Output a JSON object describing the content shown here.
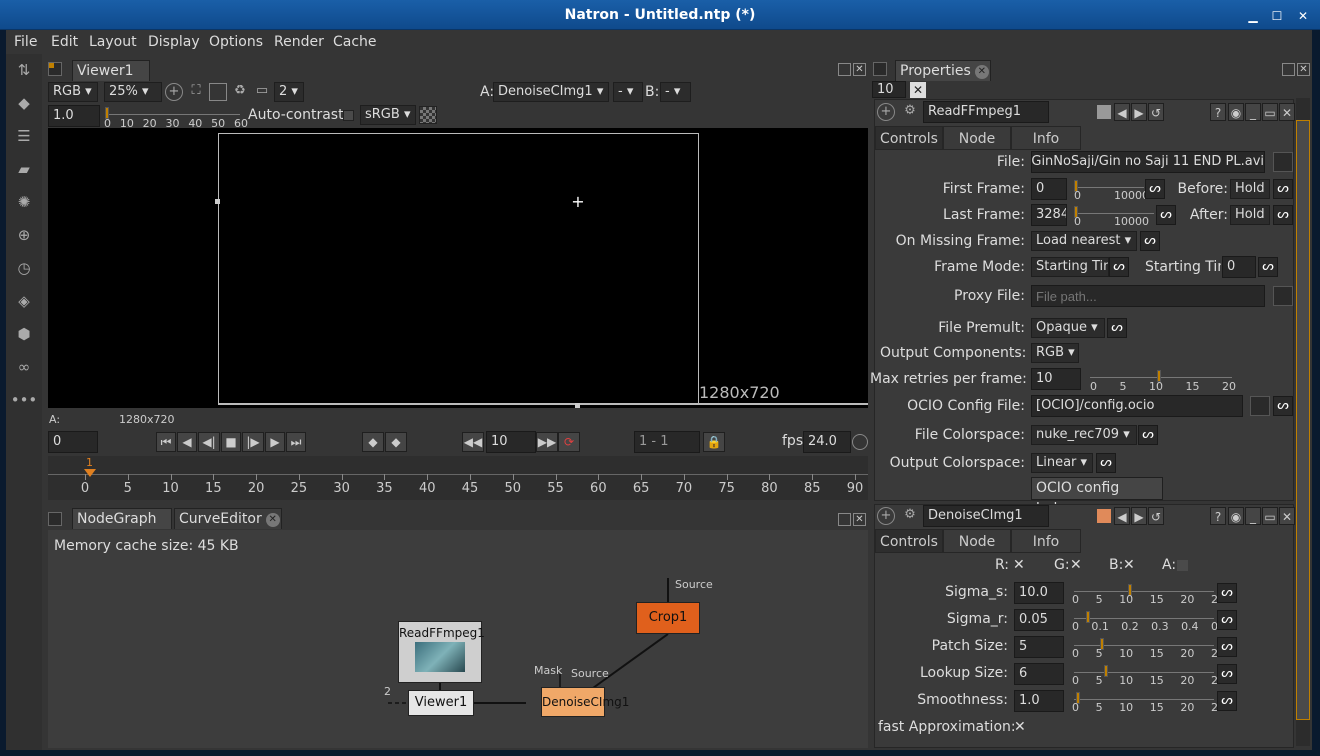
{
  "window": {
    "title": "Natron - Untitled.ntp (*)"
  },
  "menu": [
    "File",
    "Edit",
    "Layout",
    "Display",
    "Options",
    "Render",
    "Cache"
  ],
  "viewer": {
    "tab": "Viewer1",
    "channels": "RGB",
    "zoom": "25%",
    "proxy": "2",
    "input_a_label": "A:",
    "input_a": "DenoiseCImg1",
    "input_a_op": "-",
    "input_b_label": "B:",
    "input_b": "-",
    "gain": "1.0",
    "gain_ticks": [
      "0",
      "10",
      "20",
      "30",
      "40",
      "50",
      "60"
    ],
    "autocontrast": "Auto-contrast:",
    "colorspace": "sRGB",
    "resolution": "1280x720",
    "info_a": "A:",
    "info_res": "1280x720"
  },
  "playback": {
    "current": "0",
    "frame_step": "10",
    "range": "1 - 1",
    "fps_label": "fps",
    "fps": "24.0"
  },
  "timeline": {
    "marker": "1",
    "ticks": [
      "0",
      "5",
      "10",
      "15",
      "20",
      "25",
      "30",
      "35",
      "40",
      "45",
      "50",
      "55",
      "60",
      "65",
      "70",
      "75",
      "80",
      "85",
      "90"
    ]
  },
  "nodegraph": {
    "tabs": [
      "NodeGraph",
      "CurveEditor"
    ],
    "memory": "Memory cache size: 45 KB",
    "nodes": {
      "read": "ReadFFmpeg1",
      "viewer": "Viewer1",
      "denoise": "DenoiseCImg1",
      "crop": "Crop1"
    },
    "labels": {
      "source_top": "Source",
      "mask": "Mask",
      "source": "Source",
      "two": "2"
    }
  },
  "properties": {
    "tab": "Properties",
    "max_panels": "10",
    "read": {
      "name": "ReadFFmpeg1",
      "tabs": [
        "Controls",
        "Node",
        "Info"
      ],
      "file_label": "File:",
      "file": "GinNoSaji/Gin no Saji 11 END PL.avi",
      "first_label": "First Frame:",
      "first": "0",
      "first_ticks": [
        "0",
        "10000"
      ],
      "before_label": "Before:",
      "before": "Hold",
      "last_label": "Last Frame:",
      "last": "3284",
      "last_ticks": [
        "0",
        "10000"
      ],
      "after_label": "After:",
      "after": "Hold",
      "missing_label": "On Missing Frame:",
      "missing": "Load nearest",
      "mode_label": "Frame Mode:",
      "mode": "Starting Time",
      "start_label": "Starting Time",
      "start": "0",
      "proxy_label": "Proxy File:",
      "proxy_placeholder": "File path...",
      "premult_label": "File Premult:",
      "premult": "Opaque",
      "components_label": "Output Components:",
      "components": "RGB",
      "retries_label": "Max retries per frame:",
      "retries": "10",
      "retries_ticks": [
        "0",
        "5",
        "10",
        "15",
        "20"
      ],
      "ocio_label": "OCIO Config File:",
      "ocio": "[OCIO]/config.ocio",
      "filecs_label": "File Colorspace:",
      "filecs": "nuke_rec709",
      "outcs_label": "Output Colorspace:",
      "outcs": "Linear",
      "ocio_help": "OCIO config help..."
    },
    "denoise": {
      "name": "DenoiseCImg1",
      "tabs": [
        "Controls",
        "Node",
        "Info"
      ],
      "r": "R:",
      "g": "G:",
      "b": "B:",
      "a": "A:",
      "params": [
        {
          "label": "Sigma_s:",
          "value": "10.0",
          "ticks": [
            "0",
            "5",
            "10",
            "15",
            "20",
            "2"
          ]
        },
        {
          "label": "Sigma_r:",
          "value": "0.05",
          "ticks": [
            "0",
            "0.1",
            "0.2",
            "0.3",
            "0.4",
            "0"
          ]
        },
        {
          "label": "Patch Size:",
          "value": "5",
          "ticks": [
            "0",
            "5",
            "10",
            "15",
            "20",
            "2"
          ]
        },
        {
          "label": "Lookup Size:",
          "value": "6",
          "ticks": [
            "0",
            "5",
            "10",
            "15",
            "20",
            "2"
          ]
        },
        {
          "label": "Smoothness:",
          "value": "1.0",
          "ticks": [
            "0",
            "5",
            "10",
            "15",
            "20",
            "2"
          ]
        }
      ],
      "fast_label": "fast Approximation:"
    }
  },
  "colors": {
    "accent": "#c08000",
    "crop": "#e0601c",
    "denoise": "#f0a868",
    "title_bar": "#1a5fa8"
  }
}
